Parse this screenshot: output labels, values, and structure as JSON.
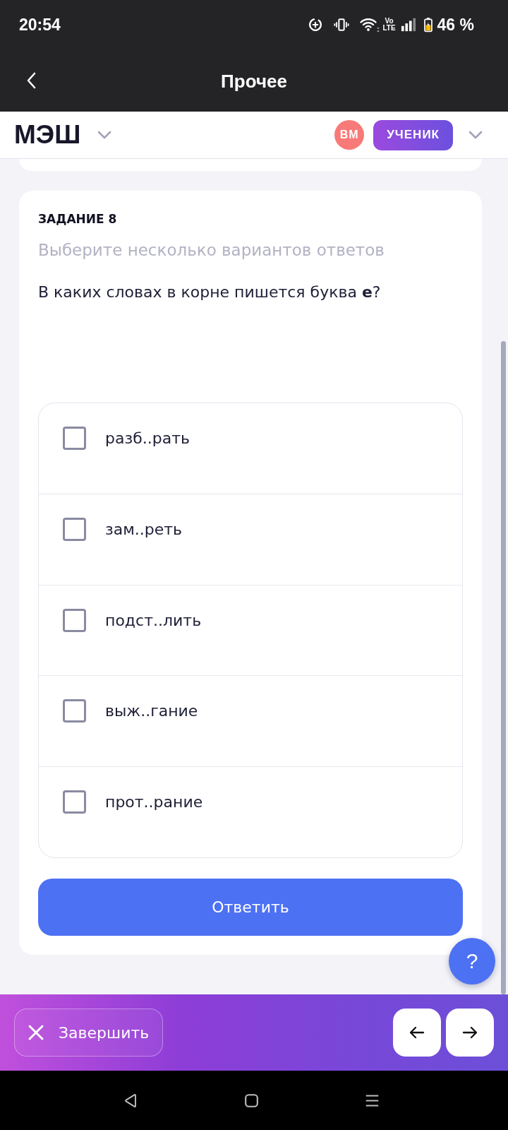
{
  "status_bar": {
    "time": "20:54",
    "network_label": [
      "Vo",
      "LTE"
    ],
    "battery": "46 %"
  },
  "app_bar": {
    "title": "Прочее"
  },
  "site_header": {
    "logo": "МЭШ",
    "avatar_initials": "ВМ",
    "role": "УЧЕНИК"
  },
  "task": {
    "title": "ЗАДАНИЕ 8",
    "hint": "Выберите несколько вариантов ответов",
    "question": "В каких словах в корне пишется буква **е**?",
    "options": [
      {
        "label": "разб..рать",
        "checked": false
      },
      {
        "label": "зам..реть",
        "checked": false
      },
      {
        "label": "подст..лить",
        "checked": false
      },
      {
        "label": "выж..гание",
        "checked": false
      },
      {
        "label": "прот..рание",
        "checked": false
      }
    ],
    "submit": "Ответить"
  },
  "help_button": {
    "label": "?"
  },
  "bottom_bar": {
    "finish": "Завершить"
  }
}
